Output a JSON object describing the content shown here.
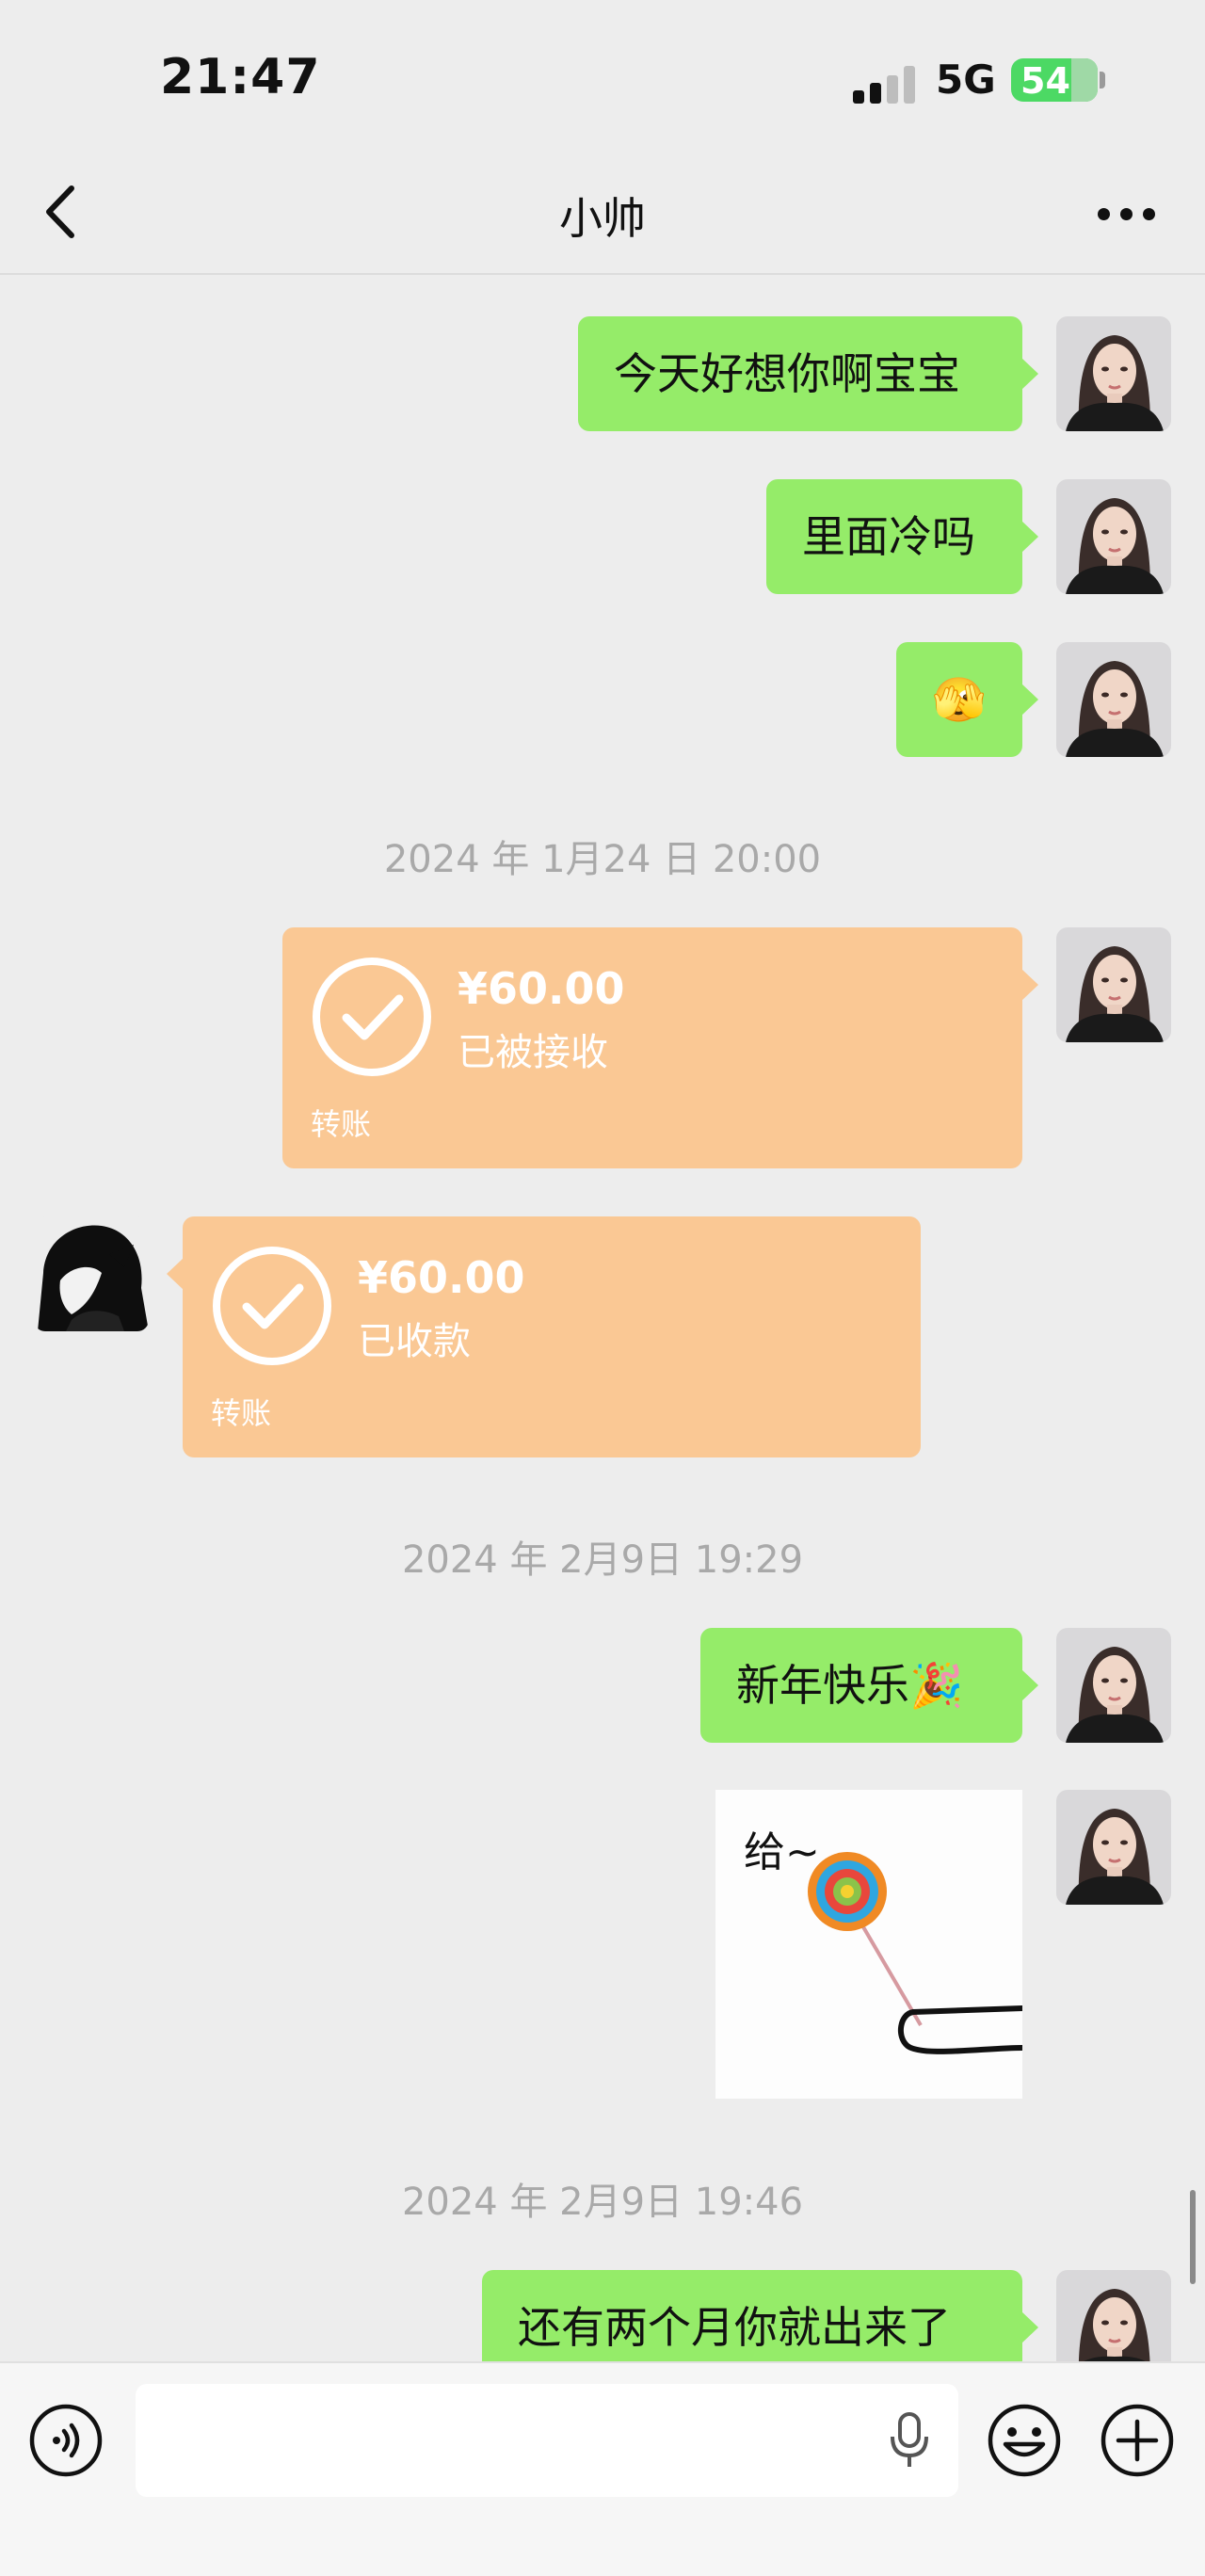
{
  "status_bar": {
    "time": "21:47",
    "network": "5G",
    "battery": "54"
  },
  "nav": {
    "title": "小帅",
    "back_icon": "chevron-left-icon",
    "more_icon": "more-horizontal-icon"
  },
  "messages": {
    "msg1": "今天好想你啊宝宝",
    "msg2": "里面冷吗",
    "msg3_emoji": "🫣",
    "time1": "2024 年 1月24 日 20:00",
    "transfer1": {
      "amount": "¥60.00",
      "status": "已被接收",
      "label": "转账"
    },
    "transfer2": {
      "amount": "¥60.00",
      "status": "已收款",
      "label": "转账"
    },
    "time2": "2024 年 2月9日 19:29",
    "msg4": "新年快乐🎉",
    "image_caption": "给~",
    "time3": "2024 年 2月9日 19:46",
    "msg5": "还有两个月你就出来了"
  },
  "input_bar": {
    "voice_icon": "voice-icon",
    "input_placeholder": "",
    "mic_icon": "microphone-icon",
    "emoji_icon": "emoji-icon",
    "plus_icon": "plus-icon"
  },
  "colors": {
    "background": "#EDEDED",
    "sent_bubble": "#95EC69",
    "transfer_card": "#FAC894",
    "timestamp_text": "#A9A9A9"
  }
}
